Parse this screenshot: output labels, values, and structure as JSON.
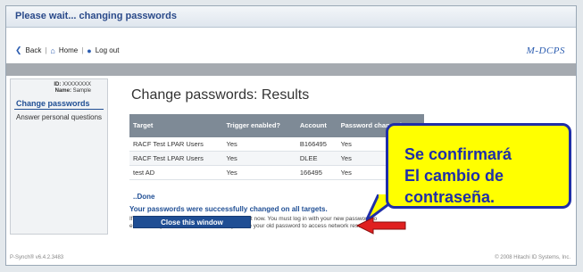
{
  "window_title": "Please wait... changing passwords",
  "nav": {
    "back": "Back",
    "home": "Home",
    "logout": "Log out",
    "brand": "M-DCPS"
  },
  "sidebar": {
    "id_label": "ID:",
    "id_value": "XXXXXXXX",
    "name_label": "Name:",
    "name_value": "Sample",
    "items": [
      {
        "label": "Change passwords",
        "active": true
      },
      {
        "label": "Answer personal questions",
        "active": false
      }
    ]
  },
  "main": {
    "title": "Change passwords: Results",
    "table": {
      "headers": [
        "Target",
        "Trigger enabled?",
        "Account",
        "Password changed?"
      ],
      "rows": [
        [
          "RACF Test LPAR Users",
          "Yes",
          "B166495",
          "Yes"
        ],
        [
          "RACF Test LPAR Users",
          "Yes",
          "DLEE",
          "Yes"
        ],
        [
          "test AD",
          "Yes",
          "166495",
          "Yes"
        ]
      ]
    },
    "done": "..Done",
    "success": "Your passwords were successfully changed on all targets.",
    "message": "If you were logged into your workstation, log out now. You must log in with your new password to ensure that your workstation does not try to use your old password to access network resources.",
    "close_button": "Close this window"
  },
  "footer": {
    "version": "P-Synch® v6.4.2.3483",
    "copyright": "© 2008 Hitachi ID Systems, Inc."
  },
  "callout": {
    "line1": "Se confirmará",
    "line2": "El cambio de",
    "line3": "contraseña."
  },
  "colors": {
    "accent": "#1f4e94",
    "callout_fill": "#ffff00",
    "callout_border": "#1f2ea8",
    "arrow": "#e02020"
  }
}
